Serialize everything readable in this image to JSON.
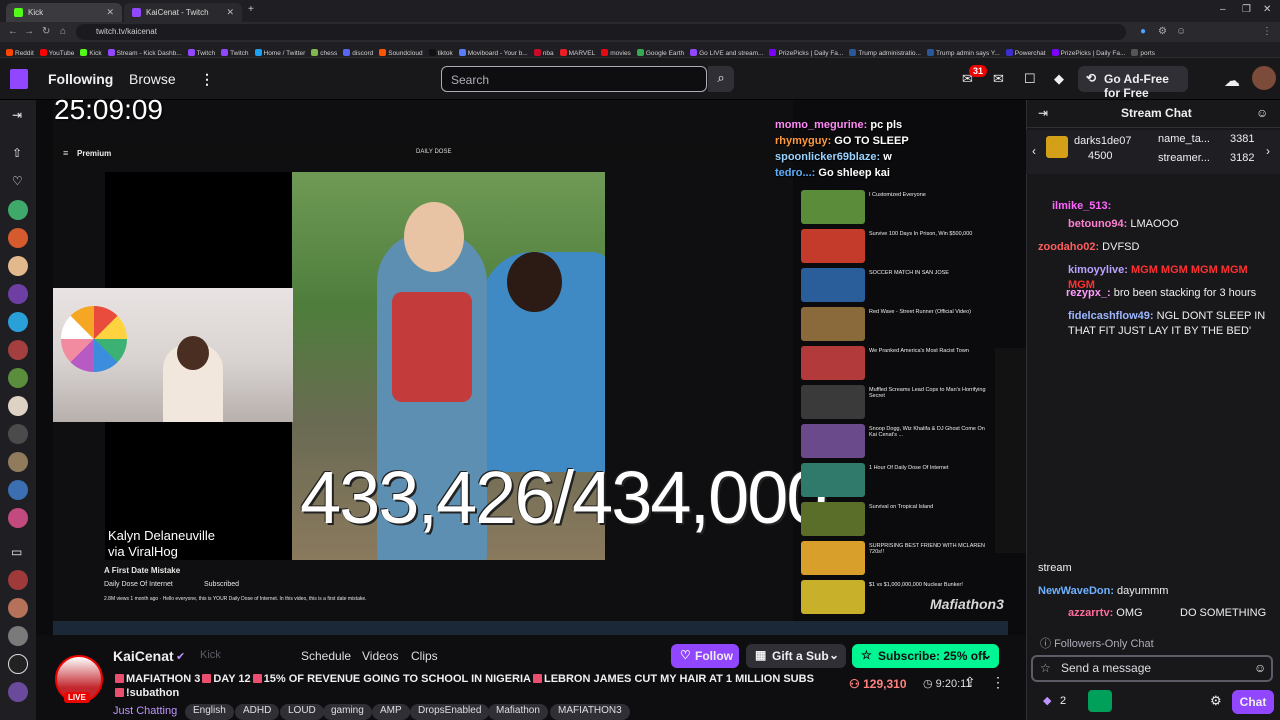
{
  "browser": {
    "tabs": [
      {
        "label": "Kick",
        "color": "#53fc18"
      },
      {
        "label": "KaiCenat - Twitch",
        "color": "#9147ff"
      }
    ],
    "url": "twitch.tv/kaicenat",
    "bookmarks": [
      "Reddit",
      "YouTube",
      "Kick",
      "Stream - Kick Dashb...",
      "Twitch",
      "Twitch",
      "Home / Twitter",
      "chess",
      "discord",
      "Soundcloud",
      "tiktok",
      "Moviboard - Your b...",
      "nba",
      "MARVEL",
      "movies",
      "Google Earth",
      "Go LIVE and stream...",
      "PrizePicks | Daily Fa...",
      "Trump administratio...",
      "Trump admin says Y...",
      "Powerchat",
      "PrizePicks | Daily Fa...",
      "ports"
    ]
  },
  "nav": {
    "following": "Following",
    "browse": "Browse",
    "search_placeholder": "Search",
    "notif_count": "31",
    "adfree_label": "Go Ad-Free for Free"
  },
  "stream_overlay": {
    "clock": "25:09:09",
    "caption_line1": "Kalyn Delaneuville",
    "caption_line2": "via ViralHog",
    "counter": "433,426/434,000",
    "yt_brand": "Premium",
    "yt_search": "DAILY DOSE",
    "yt_video_title": "A First Date Mistake",
    "yt_channel": "Daily Dose Of Internet",
    "yt_subscribed": "Subscribed",
    "yt_desc": "2.8M views 1 month ago · Hello everyone, this is YOUR Daily Dose of Internet. In this video, this is a first date mistake.",
    "mafia_logo": "Mafiathon3",
    "overlay_chat": [
      {
        "user": "momo_megurine:",
        "text": "pc pls",
        "color": "#ff8af7"
      },
      {
        "user": "rhymyguy:",
        "text": "GO TO SLEEP",
        "color": "#ff9a3c"
      },
      {
        "user": "spoonlicker69blaze:",
        "text": "w",
        "color": "#9ad3ff"
      },
      {
        "user": "tedro...:",
        "text": "Go shleep kai",
        "color": "#5fb0ff"
      }
    ],
    "recs": [
      "I Customized Everyone",
      "Survive 100 Days In Prison, Win $500,000",
      "SOCCER MATCH IN SAN JOSE",
      "Red Wave - Street Runner (Official Video)",
      "We Pranked America's Most Racist Town",
      "Muffled Screams Lead Cops to Man's Horrifying Secret",
      "Snoop Dogg, Wiz Khalifa & DJ Ghost Come On Kai Cenat's ...",
      "1 Hour Of Daily Dose Of Internet",
      "Survival on Tropical Island",
      "SURPRISING BEST FRIEND WITH MCLAREN 720s!!",
      "$1 vs $1,000,000,000 Nuclear Bunker!"
    ]
  },
  "chat": {
    "title": "Stream Chat",
    "gifters": [
      {
        "name": "darks1de07",
        "value": "4500"
      },
      {
        "name": "name_ta...",
        "value": "3381"
      },
      {
        "name": "streamer...",
        "value": "3182"
      }
    ],
    "messages": [
      {
        "user": "ilmike_513:",
        "text": "",
        "color": "#ff66ff"
      },
      {
        "user": "betouno94:",
        "text": "LMAOOO",
        "color": "#ff7fd2"
      },
      {
        "user": "zoodaho02:",
        "text": "DVFSD",
        "color": "#ff5e5e"
      },
      {
        "user": "kimoyylive:",
        "text": "MGM MGM MGM MGM MGM",
        "color": "#b9a3ff"
      },
      {
        "user": "rezypx_:",
        "text": "bro been stacking for 3 hours",
        "color": "#ff9dfd"
      },
      {
        "user": "fidelcashflow49:",
        "text": "NGL DONT SLEEP IN THAT FIT JUST LAY IT BY THE BED'",
        "color": "#9db6ff"
      },
      {
        "user": "",
        "text": "stream",
        "color": "#efeff1"
      },
      {
        "user": "NewWaveDon:",
        "text": "dayummm",
        "color": "#6fb2ff"
      },
      {
        "user": "azzarrtv:",
        "text": "OMG",
        "color": "#ff6b9a"
      },
      {
        "user": "",
        "text": "DO SOMETHING",
        "color": "#efeff1"
      }
    ],
    "followers_only": "Followers-Only Chat",
    "send_placeholder": "Send a message",
    "points": "2",
    "chat_button": "Chat"
  },
  "channel": {
    "name": "KaiCenat",
    "kick": "Kick",
    "tabs": [
      "Schedule",
      "Videos",
      "Clips"
    ],
    "live": "LIVE",
    "follow": "Follow",
    "gift": "Gift a Sub",
    "subscribe": "Subscribe: 25% off",
    "title_parts": [
      "MAFIATHON 3",
      "DAY 12",
      "15% OF REVENUE GOING TO SCHOOL IN NIGERIA",
      "LEBRON JAMES CUT MY HAIR AT 1 MILLION SUBS",
      "!subathon"
    ],
    "viewers": "129,310",
    "uptime": "9:20:11",
    "category": "Just Chatting",
    "tags": [
      "English",
      "ADHD",
      "LOUD",
      "gaming",
      "AMP",
      "DropsEnabled",
      "Mafiathon",
      "MAFIATHON3"
    ]
  }
}
